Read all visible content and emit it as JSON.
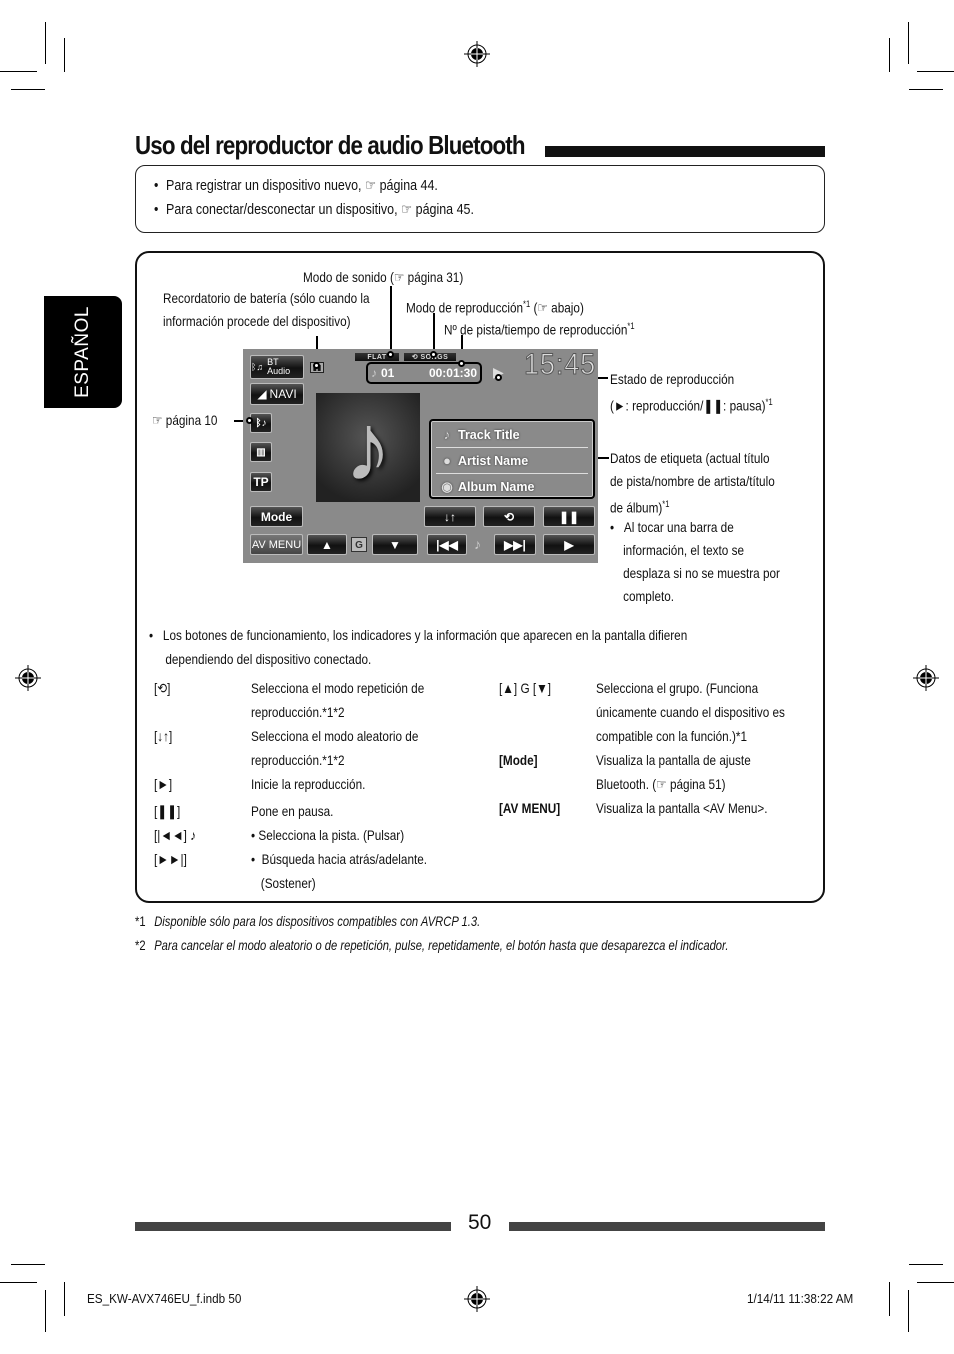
{
  "title": "Uso del reproductor de audio Bluetooth",
  "language_tab": "ESPAÑOL",
  "intro_notes": [
    {
      "text": "Para registrar un dispositivo nuevo, ☞ página 44."
    },
    {
      "text": "Para conectar/desconectar un dispositivo, ☞ página 45."
    }
  ],
  "callouts": {
    "sound_mode": "Modo de sonido (☞ página 31)",
    "battery_line1": "Recordatorio de batería (sólo cuando la",
    "battery_line2": "información procede del dispositivo)",
    "play_mode": "Modo de reproducción",
    "play_mode_sup": "*1",
    "play_mode_ref": " (☞ abajo)",
    "track_time": "Nº de pista/tiempo de reproducción",
    "track_time_sup": "*1",
    "page_ref": "☞ página 10",
    "play_status_line1": "Estado de reproducción",
    "play_status_line2": "(►: reproducción/❚❚: pausa)",
    "play_status_sup": "*1",
    "tag_line1": "Datos de etiqueta (actual título",
    "tag_line2": "de pista/nombre de artista/título",
    "tag_line3": "de álbum)",
    "tag_sup": "*1",
    "tag_bullet_lines": [
      "Al tocar una barra de",
      "información, el texto se",
      "desplaza si no se muestra por",
      "completo."
    ]
  },
  "screen": {
    "source_button": "BT Audio",
    "navi_button": "NAVI",
    "tp_button": "TP",
    "mode_button": "Mode",
    "av_menu_button": "AV MENU",
    "sound_mode_indicator": "FLAT",
    "play_mode_indicator": "SONGS",
    "track_number": "01",
    "play_time": "00:01:30",
    "clock": "15:45",
    "track_title": "Track Title",
    "artist_name": "Artist Name",
    "album_name": "Album Name",
    "group_label": "G"
  },
  "general_note": [
    "Los botones de funcionamiento, los indicadores y la información que aparecen en la pantalla difieren",
    "dependiendo del dispositivo conectado."
  ],
  "button_table_left": [
    {
      "key": "[⟲]",
      "desc": [
        "Selecciona el modo repetición de",
        "reproducción.*1*2"
      ]
    },
    {
      "key": "[↓↑]",
      "desc": [
        "Selecciona el modo aleatorio de",
        "reproducción.*1*2"
      ]
    },
    {
      "key": "[►]",
      "desc": [
        "Inicie la reproducción."
      ]
    },
    {
      "key": "[❚❚]",
      "desc": [
        "Pone en pausa."
      ]
    },
    {
      "key": "[|◄◄] ♪",
      "desc": [
        "•  Selecciona la pista. (Pulsar)"
      ]
    },
    {
      "key": "[►►|]",
      "desc": [
        "•  Búsqueda hacia atrás/adelante.",
        "   (Sostener)"
      ]
    }
  ],
  "button_table_right": [
    {
      "key": "[▲] G [▼]",
      "desc": [
        "Selecciona el grupo. (Funciona",
        "únicamente cuando el dispositivo es",
        "compatible con la función.)*1"
      ]
    },
    {
      "key": "[Mode]",
      "desc": [
        "Visualiza la pantalla de ajuste",
        "Bluetooth. (☞ página 51)"
      ]
    },
    {
      "key": "[AV MENU]",
      "desc": [
        "Visualiza la pantalla <AV Menu>."
      ]
    }
  ],
  "footnotes": [
    {
      "mark": "*1",
      "text": "Disponible sólo para los dispositivos compatibles con AVRCP 1.3."
    },
    {
      "mark": "*2",
      "text": "Para cancelar el modo aleatorio o de repetición, pulse, repetidamente, el botón hasta que desaparezca el indicador."
    }
  ],
  "page_number": "50",
  "slug": {
    "file": "ES_KW-AVX746EU_f.indb   50",
    "datetime": "1/14/11   11:38:22 AM"
  }
}
